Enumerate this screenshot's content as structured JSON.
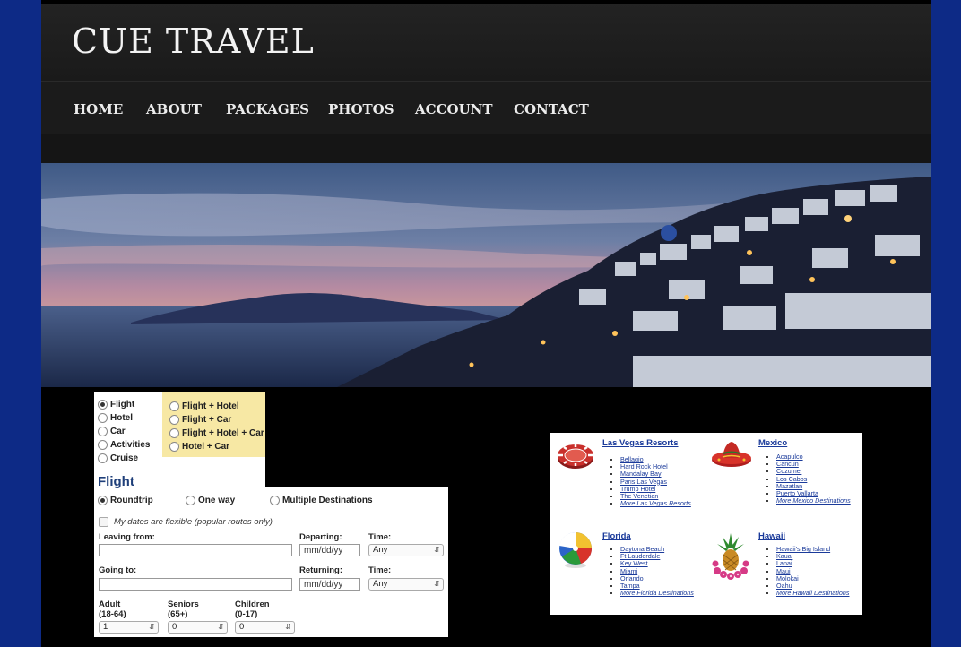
{
  "site": {
    "logo": "CUE TRAVEL"
  },
  "nav": [
    {
      "label": "HOME"
    },
    {
      "label": "ABOUT"
    },
    {
      "label": "PACKAGES"
    },
    {
      "label": "PHOTOS"
    },
    {
      "label": "ACCOUNT"
    },
    {
      "label": "CONTACT"
    }
  ],
  "search": {
    "product_types": [
      {
        "label": "Flight",
        "checked": true
      },
      {
        "label": "Hotel",
        "checked": false
      },
      {
        "label": "Car",
        "checked": false
      },
      {
        "label": "Activities",
        "checked": false
      },
      {
        "label": "Cruise",
        "checked": false
      }
    ],
    "packages": [
      {
        "label": "Flight + Hotel"
      },
      {
        "label": "Flight + Car"
      },
      {
        "label": "Flight + Hotel + Car"
      },
      {
        "label": "Hotel + Car"
      }
    ],
    "title": "Flight",
    "trip_types": [
      {
        "label": "Roundtrip",
        "checked": true
      },
      {
        "label": "One way",
        "checked": false
      },
      {
        "label": "Multiple Destinations",
        "checked": false
      }
    ],
    "flexible_label": "My dates are flexible (popular routes only)",
    "leaving_label": "Leaving from:",
    "leaving_value": "",
    "going_label": "Going to:",
    "going_value": "",
    "departing_label": "Departing:",
    "departing_placeholder": "mm/dd/yy",
    "returning_label": "Returning:",
    "returning_placeholder": "mm/dd/yy",
    "time_label": "Time:",
    "time_value": "Any",
    "adult_label_1": "Adult",
    "adult_label_2": "(18-64)",
    "adult_value": "1",
    "seniors_label_1": "Seniors",
    "seniors_label_2": "(65+)",
    "seniors_value": "0",
    "children_label_1": "Children",
    "children_label_2": "(0-17)",
    "children_value": "0"
  },
  "destinations": {
    "las_vegas": {
      "title": "Las Vegas Resorts",
      "items": [
        "Bellagio",
        "Hard Rock Hotel",
        "Mandalay Bay",
        "Paris Las Vegas",
        "Trump Hotel",
        "The Venetian"
      ],
      "more": "More Las Vegas Resorts",
      "icon": "poker-chip-icon"
    },
    "mexico": {
      "title": "Mexico",
      "items": [
        "Acapulco",
        "Cancun",
        "Cozumel",
        "Los Cabos",
        "Mazatlan",
        "Puerto Vallarta"
      ],
      "more": "More Mexico Destinations",
      "icon": "sombrero-icon"
    },
    "florida": {
      "title": "Florida",
      "items": [
        "Daytona Beach",
        "Ft Lauderdale",
        "Key West",
        "Miami",
        "Orlando",
        "Tampa"
      ],
      "more": "More Florida Destinations",
      "icon": "beach-ball-icon"
    },
    "hawaii": {
      "title": "Hawaii",
      "items": [
        "Hawaii's Big Island",
        "Kauai",
        "Lanai",
        "Maui",
        "Molokai",
        "Oahu"
      ],
      "more": "More Hawaii Destinations",
      "icon": "pineapple-icon"
    }
  },
  "colors": {
    "background": "#0d2a86",
    "link": "#1a3a9a",
    "package_highlight": "#f7e8a4",
    "form_title": "#1f3f7a"
  }
}
